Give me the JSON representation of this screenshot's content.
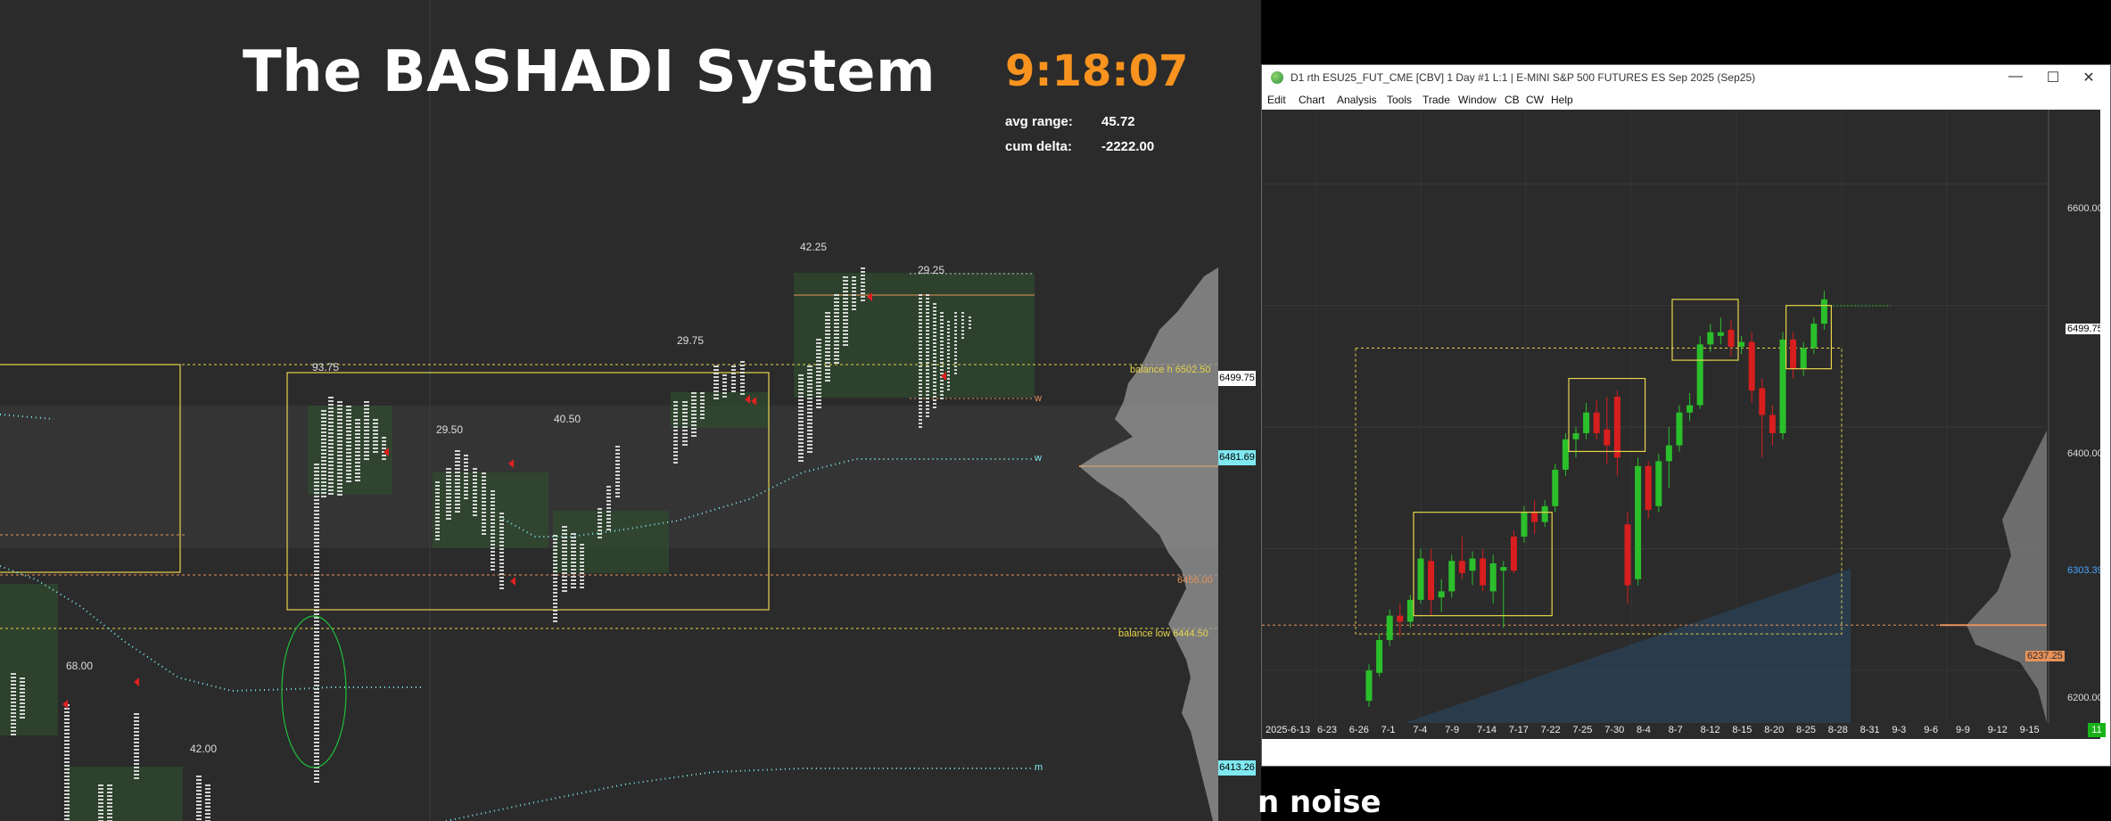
{
  "main": {
    "title": "The BASHADI System",
    "clock": "9:18:07",
    "stats": [
      {
        "label": "avg range:",
        "value": "45.72"
      },
      {
        "label": "cum delta:",
        "value": "-2222.00"
      }
    ],
    "range_labels": [
      "93.75",
      "29.50",
      "40.50",
      "29.75",
      "42.25",
      "29.25",
      "68.00",
      "42.00"
    ],
    "level_labels": {
      "balance_high": "balance h  6502.50",
      "balance_low": "balance low  6444.50",
      "level_6456": "6456.00",
      "w1": "w",
      "w2": "w",
      "m": "m"
    },
    "price_tags": [
      {
        "text": "6499.75",
        "color": "#ffffff"
      },
      {
        "text": "6481.69",
        "color": "#7fe8f0"
      },
      {
        "text": "6413.26",
        "color": "#7fe8f0"
      }
    ],
    "bottom_text": "n noise"
  },
  "window": {
    "title": "D1 rth ESU25_FUT_CME [CBV]  1 Day  #1 L:1 | E-MINI S&P 500 FUTURES ES Sep 2025 (Sep25)",
    "controls": {
      "minimize": "—",
      "maximize": "☐",
      "close": "✕"
    },
    "menu": [
      "Edit",
      "Chart",
      "Analysis",
      "Tools",
      "Trade",
      "Window",
      "CB",
      "CW",
      "Help"
    ],
    "y_labels": [
      "6600.00",
      "6499.75",
      "6400.00",
      "6303.39",
      "6237.25",
      "6200.00"
    ],
    "date_labels": [
      "2025-6-13",
      "6-23",
      "6-26",
      "7-1",
      "7-4",
      "7-9",
      "7-14",
      "7-17",
      "7-22",
      "7-25",
      "7-30",
      "8-4",
      "8-7",
      "8-12",
      "8-15",
      "8-20",
      "8-25",
      "8-28",
      "8-31",
      "9-3",
      "9-6",
      "9-9",
      "9-12",
      "9-15"
    ],
    "corner_badge": "11"
  },
  "chart_data": {
    "type": "candlestick",
    "symbol": "ESU25_FUT_CME",
    "timeframe": "1 Day",
    "ylim": [
      6170,
      6650
    ],
    "candles": [
      {
        "date": "6-26",
        "o": 6175,
        "h": 6205,
        "l": 6170,
        "c": 6200,
        "dir": "up"
      },
      {
        "date": "6-27",
        "o": 6198,
        "h": 6230,
        "l": 6195,
        "c": 6225,
        "dir": "up"
      },
      {
        "date": "6-30",
        "o": 6225,
        "h": 6250,
        "l": 6220,
        "c": 6245,
        "dir": "up"
      },
      {
        "date": "7-1",
        "o": 6245,
        "h": 6255,
        "l": 6228,
        "c": 6240,
        "dir": "down"
      },
      {
        "date": "7-2",
        "o": 6240,
        "h": 6262,
        "l": 6235,
        "c": 6258,
        "dir": "up"
      },
      {
        "date": "7-3",
        "o": 6258,
        "h": 6300,
        "l": 6255,
        "c": 6292,
        "dir": "up"
      },
      {
        "date": "7-7",
        "o": 6290,
        "h": 6300,
        "l": 6245,
        "c": 6258,
        "dir": "down"
      },
      {
        "date": "7-8",
        "o": 6260,
        "h": 6275,
        "l": 6248,
        "c": 6265,
        "dir": "up"
      },
      {
        "date": "7-9",
        "o": 6265,
        "h": 6295,
        "l": 6260,
        "c": 6290,
        "dir": "up"
      },
      {
        "date": "7-10",
        "o": 6290,
        "h": 6310,
        "l": 6275,
        "c": 6280,
        "dir": "down"
      },
      {
        "date": "7-11",
        "o": 6282,
        "h": 6298,
        "l": 6270,
        "c": 6292,
        "dir": "up"
      },
      {
        "date": "7-14",
        "o": 6292,
        "h": 6300,
        "l": 6265,
        "c": 6270,
        "dir": "down"
      },
      {
        "date": "7-15",
        "o": 6265,
        "h": 6295,
        "l": 6255,
        "c": 6288,
        "dir": "up"
      },
      {
        "date": "7-16",
        "o": 6285,
        "h": 6290,
        "l": 6235,
        "c": 6282,
        "dir": "up"
      },
      {
        "date": "7-17",
        "o": 6282,
        "h": 6315,
        "l": 6280,
        "c": 6310,
        "dir": "down"
      },
      {
        "date": "7-18",
        "o": 6310,
        "h": 6335,
        "l": 6305,
        "c": 6330,
        "dir": "up"
      },
      {
        "date": "7-21",
        "o": 6330,
        "h": 6340,
        "l": 6312,
        "c": 6322,
        "dir": "down"
      },
      {
        "date": "7-22",
        "o": 6322,
        "h": 6340,
        "l": 6318,
        "c": 6335,
        "dir": "up"
      },
      {
        "date": "7-23",
        "o": 6335,
        "h": 6370,
        "l": 6330,
        "c": 6365,
        "dir": "up"
      },
      {
        "date": "7-24",
        "o": 6365,
        "h": 6395,
        "l": 6360,
        "c": 6390,
        "dir": "up"
      },
      {
        "date": "7-25",
        "o": 6390,
        "h": 6400,
        "l": 6375,
        "c": 6395,
        "dir": "up"
      },
      {
        "date": "7-28",
        "o": 6395,
        "h": 6420,
        "l": 6390,
        "c": 6412,
        "dir": "up"
      },
      {
        "date": "7-29",
        "o": 6412,
        "h": 6422,
        "l": 6390,
        "c": 6395,
        "dir": "down"
      },
      {
        "date": "7-30",
        "o": 6398,
        "h": 6425,
        "l": 6370,
        "c": 6385,
        "dir": "down"
      },
      {
        "date": "7-31",
        "o": 6425,
        "h": 6430,
        "l": 6360,
        "c": 6375,
        "dir": "down"
      },
      {
        "date": "8-1",
        "o": 6320,
        "h": 6330,
        "l": 6255,
        "c": 6270,
        "dir": "down"
      },
      {
        "date": "8-4",
        "o": 6275,
        "h": 6375,
        "l": 6270,
        "c": 6368,
        "dir": "up"
      },
      {
        "date": "8-5",
        "o": 6368,
        "h": 6372,
        "l": 6325,
        "c": 6332,
        "dir": "down"
      },
      {
        "date": "8-6",
        "o": 6335,
        "h": 6378,
        "l": 6330,
        "c": 6372,
        "dir": "up"
      },
      {
        "date": "8-7",
        "o": 6372,
        "h": 6400,
        "l": 6350,
        "c": 6385,
        "dir": "up"
      },
      {
        "date": "8-8",
        "o": 6385,
        "h": 6418,
        "l": 6380,
        "c": 6412,
        "dir": "up"
      },
      {
        "date": "8-11",
        "o": 6412,
        "h": 6428,
        "l": 6405,
        "c": 6418,
        "dir": "up"
      },
      {
        "date": "8-12",
        "o": 6418,
        "h": 6475,
        "l": 6415,
        "c": 6468,
        "dir": "up"
      },
      {
        "date": "8-13",
        "o": 6468,
        "h": 6485,
        "l": 6462,
        "c": 6478,
        "dir": "up"
      },
      {
        "date": "8-14",
        "o": 6478,
        "h": 6490,
        "l": 6468,
        "c": 6475,
        "dir": "up"
      },
      {
        "date": "8-15",
        "o": 6480,
        "h": 6488,
        "l": 6458,
        "c": 6466,
        "dir": "down"
      },
      {
        "date": "8-18",
        "o": 6466,
        "h": 6475,
        "l": 6460,
        "c": 6470,
        "dir": "up"
      },
      {
        "date": "8-19",
        "o": 6470,
        "h": 6478,
        "l": 6420,
        "c": 6430,
        "dir": "down"
      },
      {
        "date": "8-20",
        "o": 6432,
        "h": 6440,
        "l": 6375,
        "c": 6410,
        "dir": "down"
      },
      {
        "date": "8-21",
        "o": 6410,
        "h": 6418,
        "l": 6385,
        "c": 6395,
        "dir": "down"
      },
      {
        "date": "8-22",
        "o": 6395,
        "h": 6478,
        "l": 6390,
        "c": 6472,
        "dir": "up"
      },
      {
        "date": "8-25",
        "o": 6472,
        "h": 6478,
        "l": 6440,
        "c": 6448,
        "dir": "down"
      },
      {
        "date": "8-26",
        "o": 6448,
        "h": 6470,
        "l": 6442,
        "c": 6465,
        "dir": "up"
      },
      {
        "date": "8-27",
        "o": 6465,
        "h": 6490,
        "l": 6460,
        "c": 6485,
        "dir": "up"
      },
      {
        "date": "8-28",
        "o": 6485,
        "h": 6512,
        "l": 6480,
        "c": 6505,
        "dir": "up"
      }
    ]
  }
}
